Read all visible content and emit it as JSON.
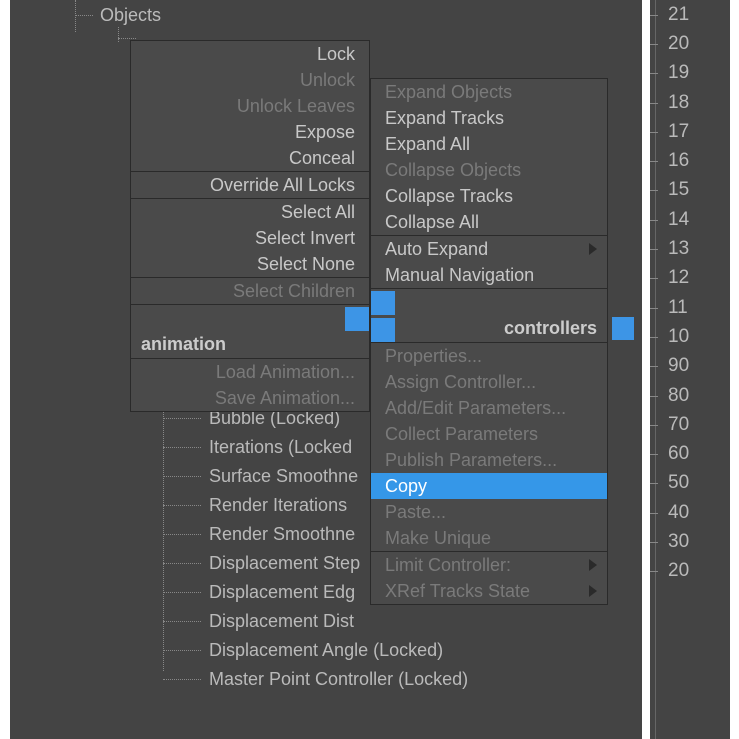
{
  "tree": {
    "root": "Objects",
    "hidden_items": [
      "Bubble (Locked)",
      "Iterations (Locked",
      "Surface Smoothne",
      "Render Iterations",
      "Render Smoothne",
      "Displacement Step",
      "Displacement Edg",
      "Displacement Dist",
      "Displacement Angle (Locked)",
      "Master Point Controller (Locked)"
    ]
  },
  "menu_left": {
    "header": "animation",
    "items1": [
      {
        "label": "Lock",
        "disabled": false
      },
      {
        "label": "Unlock",
        "disabled": true
      },
      {
        "label": "Unlock Leaves",
        "disabled": true
      },
      {
        "label": "Expose",
        "disabled": false
      },
      {
        "label": "Conceal",
        "disabled": false
      }
    ],
    "items2": [
      {
        "label": "Override All Locks",
        "disabled": false
      }
    ],
    "items3": [
      {
        "label": "Select All",
        "disabled": false
      },
      {
        "label": "Select Invert",
        "disabled": false
      },
      {
        "label": "Select None",
        "disabled": false
      }
    ],
    "items4": [
      {
        "label": "Select Children",
        "disabled": true
      }
    ],
    "items5": [
      {
        "label": "Load Animation...",
        "disabled": true
      },
      {
        "label": "Save Animation...",
        "disabled": true
      }
    ]
  },
  "menu_right": {
    "header": "controllers",
    "items1": [
      {
        "label": "Expand Objects",
        "disabled": true
      },
      {
        "label": "Expand Tracks",
        "disabled": false
      },
      {
        "label": "Expand All",
        "disabled": false
      },
      {
        "label": "Collapse Objects",
        "disabled": true
      },
      {
        "label": "Collapse Tracks",
        "disabled": false
      },
      {
        "label": "Collapse All",
        "disabled": false
      }
    ],
    "items2": [
      {
        "label": "Auto Expand",
        "disabled": false,
        "submenu": true
      },
      {
        "label": "Manual Navigation",
        "disabled": false
      }
    ],
    "items3": [
      {
        "label": "Properties...",
        "disabled": true
      },
      {
        "label": "Assign Controller...",
        "disabled": true
      },
      {
        "label": "Add/Edit Parameters...",
        "disabled": true
      },
      {
        "label": "Collect Parameters",
        "disabled": true
      },
      {
        "label": "Publish Parameters...",
        "disabled": true
      },
      {
        "label": "Copy",
        "disabled": false,
        "highlighted": true
      },
      {
        "label": "Paste...",
        "disabled": true
      },
      {
        "label": "Make Unique",
        "disabled": true
      }
    ],
    "items4": [
      {
        "label": "Limit Controller:",
        "disabled": true,
        "submenu": true
      },
      {
        "label": "XRef Tracks State",
        "disabled": true,
        "submenu": true
      }
    ]
  },
  "ruler": [
    "21",
    "20",
    "19",
    "18",
    "17",
    "16",
    "15",
    "14",
    "13",
    "12",
    "11",
    "10",
    "90",
    "80",
    "70",
    "60",
    "50",
    "40",
    "30",
    "20"
  ]
}
